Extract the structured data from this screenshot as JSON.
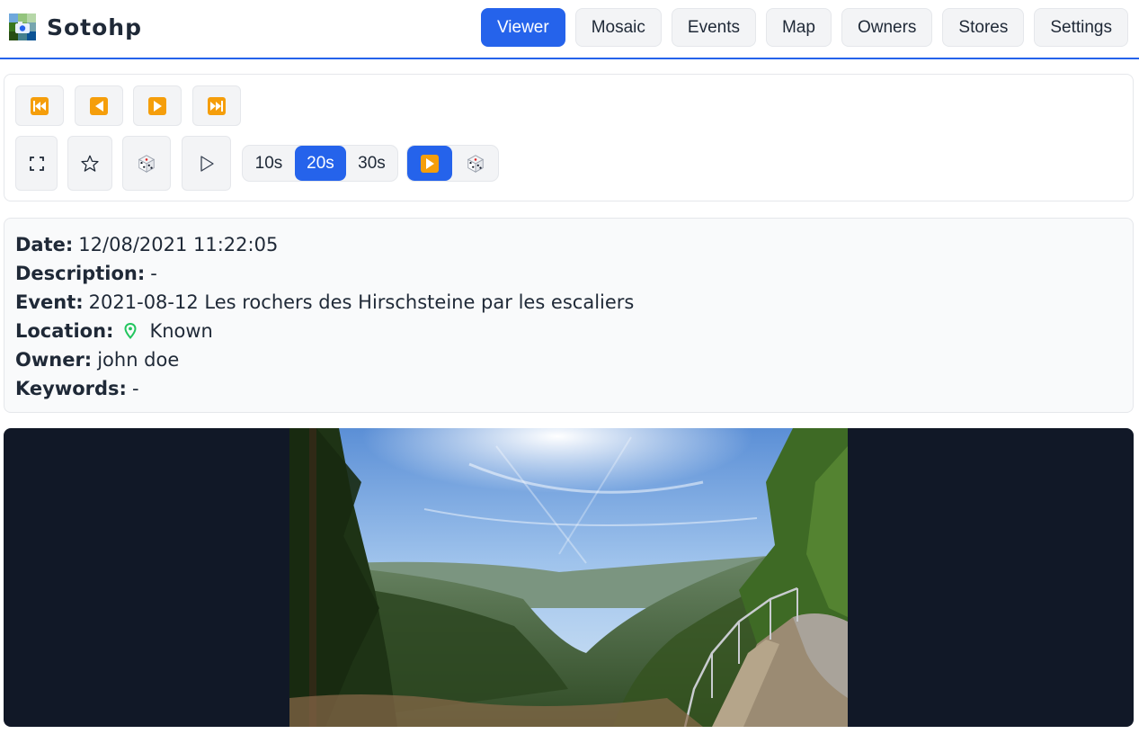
{
  "app": {
    "name": "Sotohp"
  },
  "nav": {
    "items": [
      {
        "label": "Viewer",
        "active": true
      },
      {
        "label": "Mosaic",
        "active": false
      },
      {
        "label": "Events",
        "active": false
      },
      {
        "label": "Map",
        "active": false
      },
      {
        "label": "Owners",
        "active": false
      },
      {
        "label": "Stores",
        "active": false
      },
      {
        "label": "Settings",
        "active": false
      }
    ]
  },
  "controls": {
    "navigation": [
      "first-icon",
      "previous-icon",
      "next-icon",
      "last-icon"
    ],
    "actions": [
      "fullscreen-icon",
      "star-icon",
      "random-icon",
      "slideshow-play-icon"
    ],
    "intervals": [
      {
        "label": "10s",
        "active": false
      },
      {
        "label": "20s",
        "active": true
      },
      {
        "label": "30s",
        "active": false
      }
    ],
    "modes": [
      {
        "icon": "sequential-play-icon",
        "active": true
      },
      {
        "icon": "random-dice-icon",
        "active": false
      }
    ],
    "accent": "#2563eb",
    "icon_color": "#f59e0b"
  },
  "info": {
    "date_label": "Date:",
    "date_value": "12/08/2021 11:22:05",
    "description_label": "Description:",
    "description_value": "-",
    "event_label": "Event:",
    "event_value": "2021-08-12 Les rochers des Hirschsteine par les escaliers",
    "location_label": "Location:",
    "location_icon": "map-pin-icon",
    "location_value": "Known",
    "owner_label": "Owner:",
    "owner_value": "john doe",
    "keywords_label": "Keywords:",
    "keywords_value": "-"
  },
  "viewer": {
    "background": "#111827",
    "photo_subject": "forest-valley-panorama"
  }
}
